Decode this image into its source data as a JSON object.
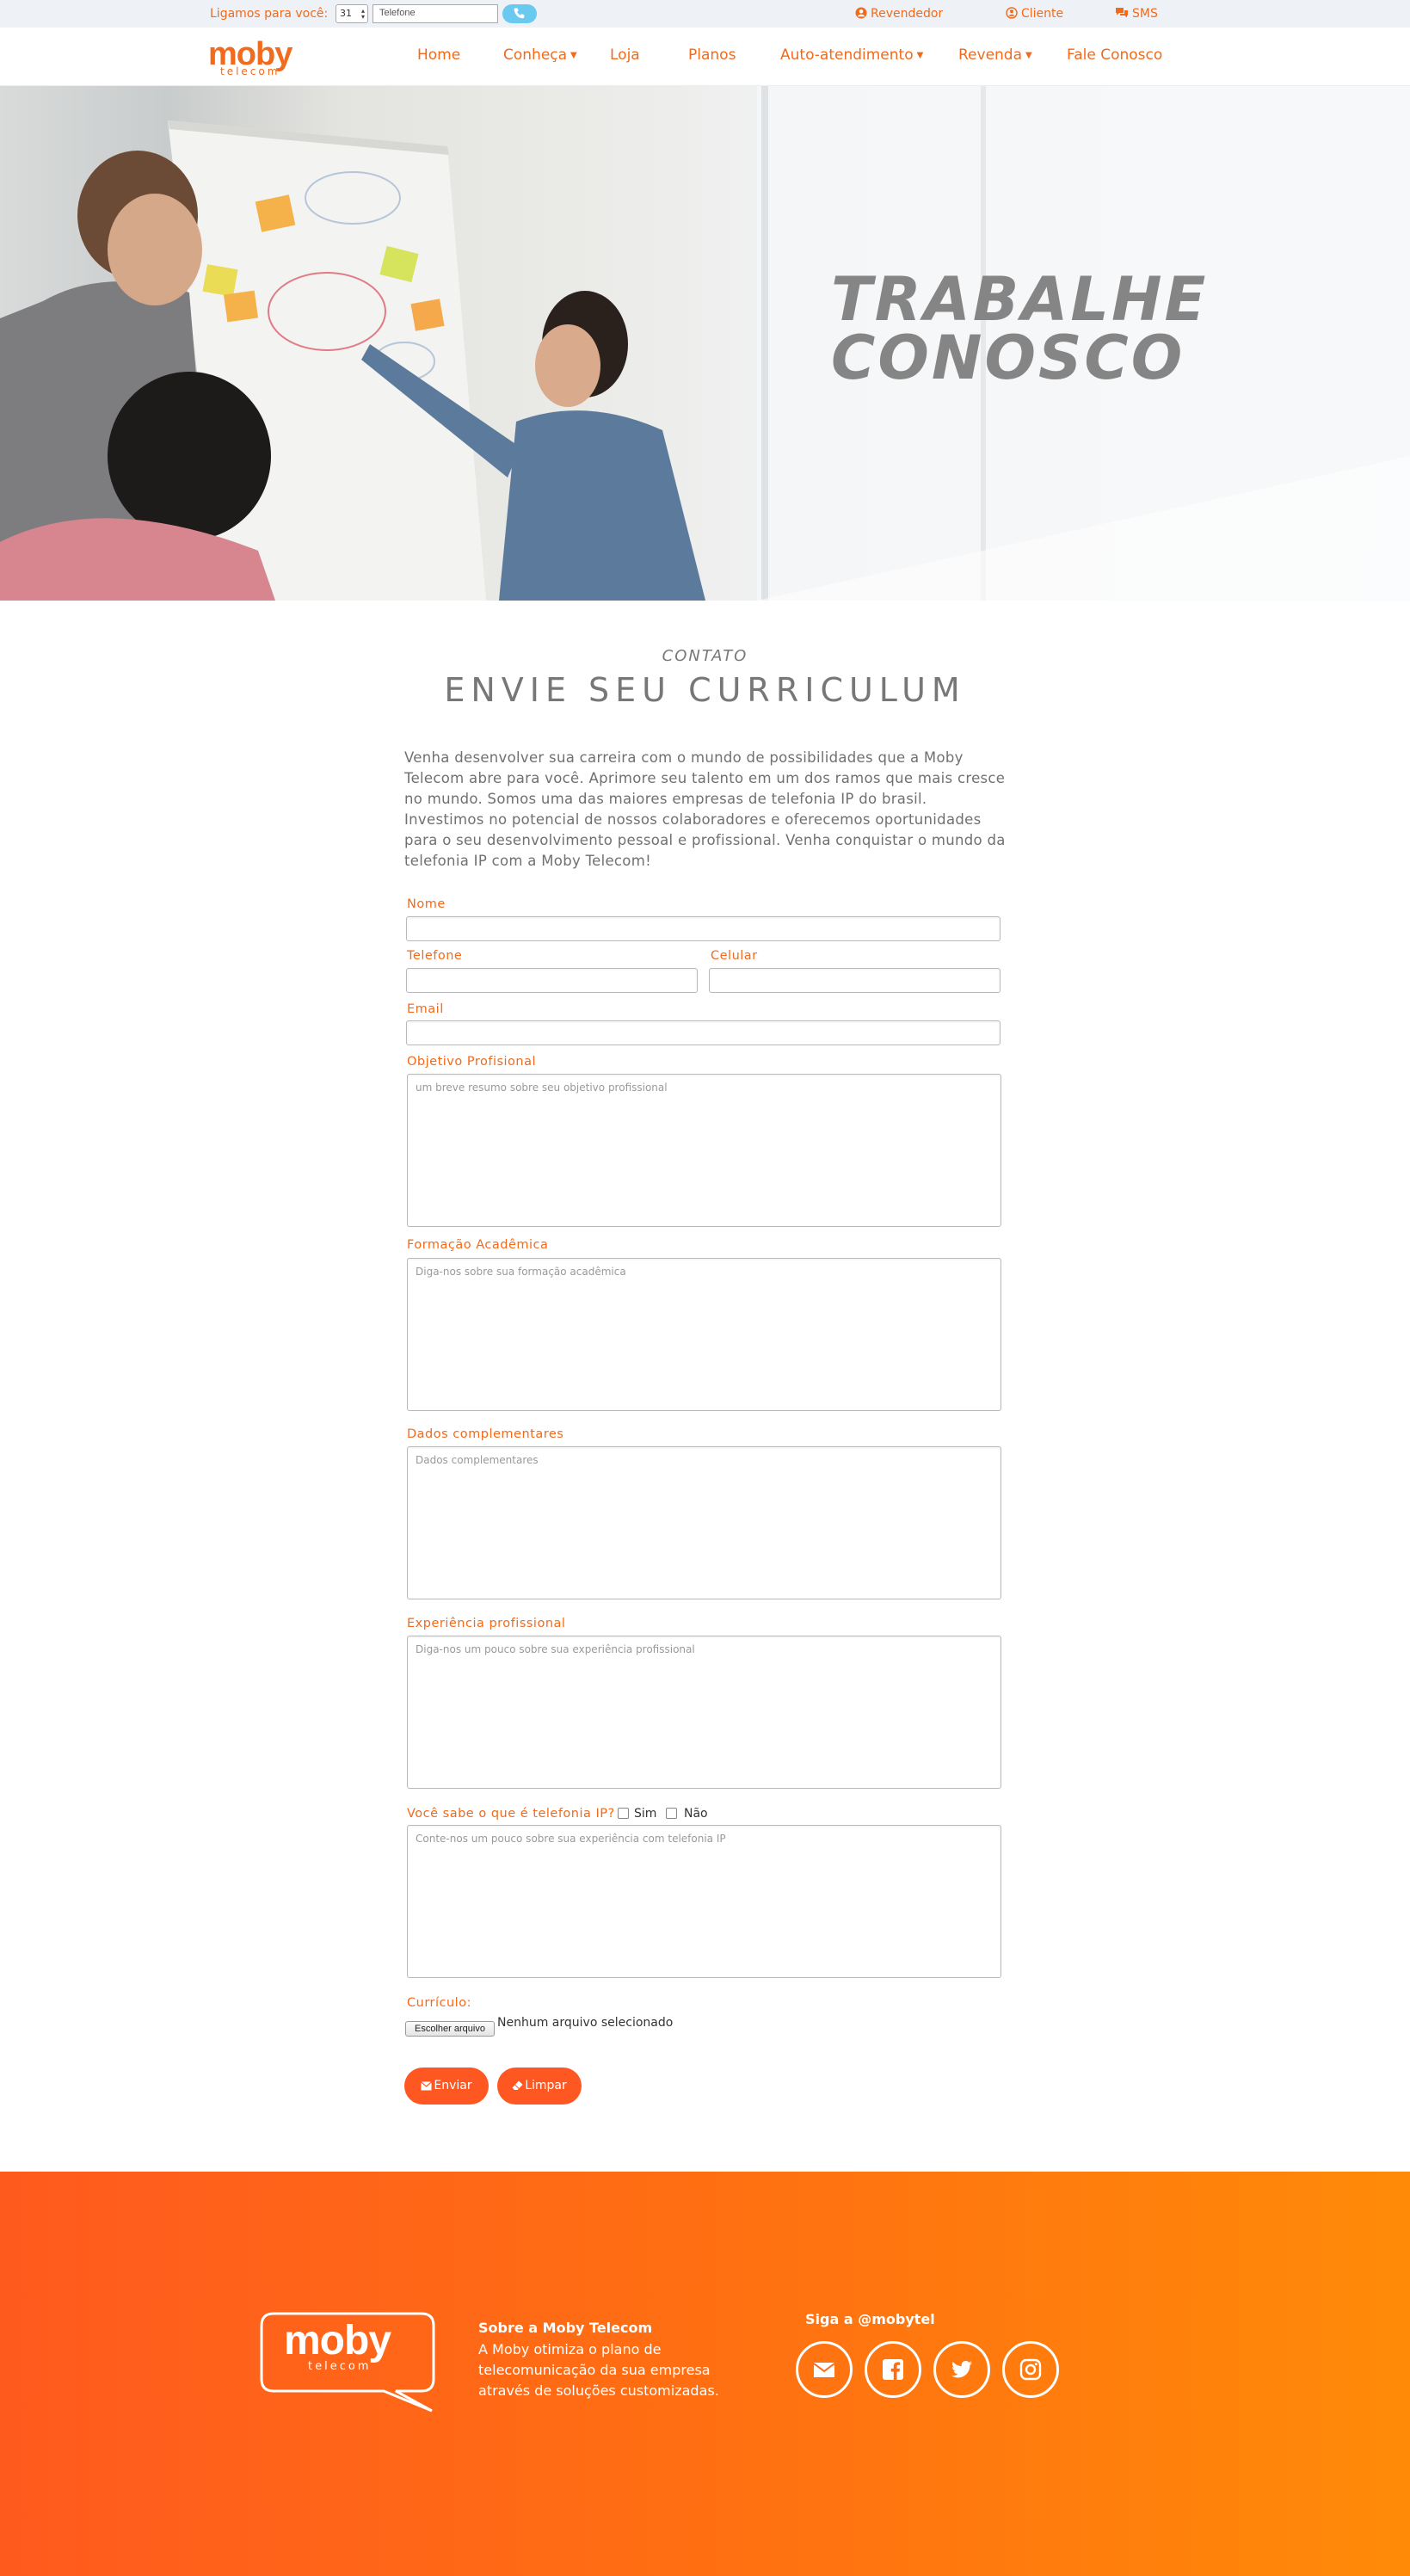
{
  "topbar": {
    "call_label": "Ligamos para você:",
    "ddd_value": "31",
    "phone_placeholder": "Telefone",
    "links": {
      "reseller": "Revendedor",
      "client": "Cliente",
      "sms": "SMS"
    }
  },
  "brand": {
    "name": "moby",
    "sub": "telecom",
    "accent": "#f26a1b"
  },
  "nav": {
    "home": "Home",
    "conheca": "Conheça",
    "loja": "Loja",
    "planos": "Planos",
    "auto": "Auto-atendimento",
    "revenda": "Revenda",
    "fale": "Fale Conosco"
  },
  "hero": {
    "line1": "TRABALHE",
    "line2": "CONOSCO"
  },
  "section": {
    "kicker": "CONTATO",
    "title": "ENVIE SEU CURRICULUM",
    "intro": "Venha desenvolver sua carreira com o mundo de possibilidades que a Moby Telecom abre para você. Aprimore seu talento em um dos ramos que mais cresce no mundo. Somos uma das maiores empresas de telefonia IP do brasil. Investimos no potencial de nossos colaboradores e oferecemos oportunidades para o seu desenvolvimento pessoal e profissional. Venha conquistar o mundo da telefonia IP com a Moby Telecom!"
  },
  "form": {
    "nome_label": "Nome",
    "telefone_label": "Telefone",
    "celular_label": "Celular",
    "email_label": "Email",
    "objetivo_label": "Objetivo Profisional",
    "objetivo_placeholder": "um breve resumo sobre seu objetivo profissional",
    "formacao_label": "Formação Acadêmica",
    "formacao_placeholder": "Diga-nos sobre sua formação acadêmica",
    "dados_label": "Dados complementares",
    "dados_placeholder": "Dados complementares",
    "experiencia_label": "Experiência profissional",
    "experiencia_placeholder": "Diga-nos um pouco sobre sua experiência profissional",
    "voip_question": "Você sabe o que é telefonia IP?",
    "voip_yes": "Sim",
    "voip_no": "Não",
    "voip_placeholder": "Conte-nos um pouco sobre sua experiência com telefonia IP",
    "curriculo_label": "Currículo:",
    "file_button": "Escolher arquivo",
    "file_status": "Nenhum arquivo selecionado",
    "submit": "Enviar",
    "reset": "Limpar"
  },
  "footer": {
    "about_title": "Sobre a Moby Telecom",
    "about_text": "A Moby otimiza o plano de telecomunicação da sua empresa através de soluções customizadas.",
    "follow": "Siga a @mobytel",
    "social": [
      "email-icon",
      "facebook-icon",
      "twitter-icon",
      "instagram-icon"
    ]
  }
}
